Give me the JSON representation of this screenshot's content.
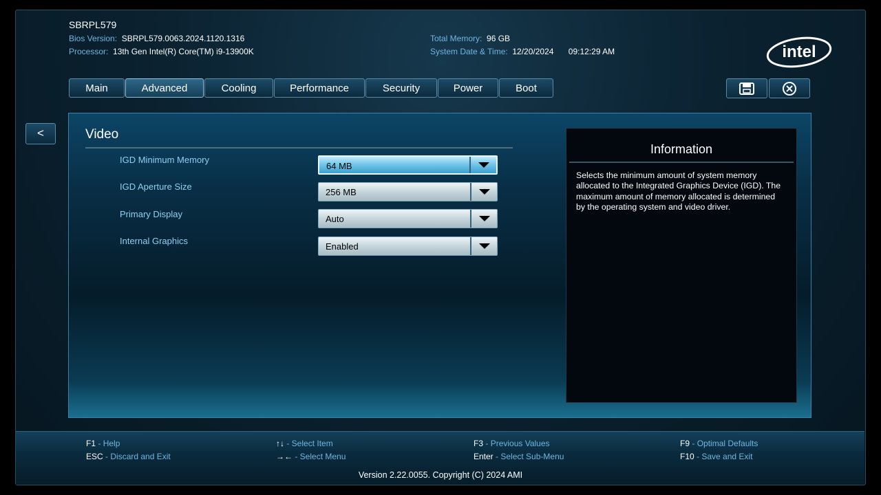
{
  "header": {
    "device_name": "SBRPL579",
    "bios_version_label": "Bios Version:",
    "bios_version_value": "SBRPL579.0063.2024.1120.1316",
    "processor_label": "Processor:",
    "processor_value": "13th Gen Intel(R) Core(TM) i9-13900K",
    "total_memory_label": "Total Memory:",
    "total_memory_value": "96 GB",
    "datetime_label": "System Date & Time:",
    "date_value": "12/20/2024",
    "time_value": "09:12:29 AM",
    "logo_text": "intel"
  },
  "tabs": [
    {
      "label": "Main"
    },
    {
      "label": "Advanced"
    },
    {
      "label": "Cooling"
    },
    {
      "label": "Performance"
    },
    {
      "label": "Security"
    },
    {
      "label": "Power"
    },
    {
      "label": "Boot"
    }
  ],
  "active_tab": "Advanced",
  "toolbar": {
    "save_icon": "floppy-disk-icon",
    "exit_icon": "close-circle-icon"
  },
  "back_button": "<",
  "section": {
    "title": "Video",
    "settings": [
      {
        "label": "IGD Minimum Memory",
        "value": "64 MB"
      },
      {
        "label": "IGD Aperture Size",
        "value": "256 MB"
      },
      {
        "label": "Primary Display",
        "value": "Auto"
      },
      {
        "label": "Internal Graphics",
        "value": "Enabled"
      }
    ]
  },
  "info": {
    "title": "Information",
    "text": "Selects the minimum amount of system memory allocated to the Integrated Graphics Device (IGD). The maximum amount of memory allocated is determined by the operating system and video driver."
  },
  "footer": {
    "keys": [
      {
        "key": "F1",
        "desc": "Help"
      },
      {
        "key": "ESC",
        "desc": "Discard and Exit"
      },
      {
        "key": "↑↓",
        "desc": "Select Item"
      },
      {
        "key": "→←",
        "desc": "Select Menu"
      },
      {
        "key": "F3",
        "desc": "Previous Values"
      },
      {
        "key": "Enter",
        "desc": "Select Sub-Menu"
      },
      {
        "key": "F9",
        "desc": "Optimal Defaults"
      },
      {
        "key": "F10",
        "desc": "Save and Exit"
      }
    ],
    "separator": " - ",
    "version": "Version 2.22.0055. Copyright (C) 2024 AMI"
  },
  "colors": {
    "accent": "#6fb6e3",
    "label": "#8fd0f2",
    "focus": "#6dc3e8"
  }
}
